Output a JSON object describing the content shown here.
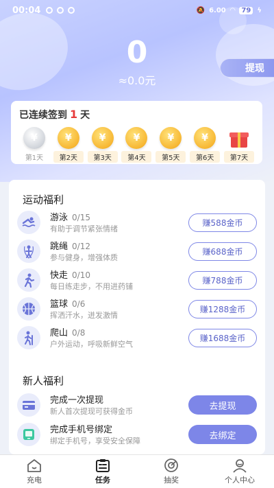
{
  "status_bar": {
    "time": "00:04",
    "network_speed": "6.00",
    "battery": "79"
  },
  "balance": {
    "coins": "0",
    "yuan": "≈0.0元"
  },
  "withdraw_label": "提现",
  "signin": {
    "prefix": "已连续签到",
    "days": "1",
    "suffix": "天",
    "days_list": [
      {
        "label": "第1天",
        "coin": "¥",
        "claimed": true
      },
      {
        "label": "第2天",
        "coin": "¥"
      },
      {
        "label": "第3天",
        "coin": "¥"
      },
      {
        "label": "第4天",
        "coin": "¥"
      },
      {
        "label": "第5天",
        "coin": "¥"
      },
      {
        "label": "第6天",
        "coin": "¥"
      },
      {
        "label": "第7天",
        "icon": "gift-icon"
      }
    ]
  },
  "sports": {
    "title": "运动福利",
    "items": [
      {
        "name": "游泳",
        "count": "0/15",
        "desc": "有助于调节紧张情绪",
        "button": "赚588金币",
        "icon": "swimming-icon"
      },
      {
        "name": "跳绳",
        "count": "0/12",
        "desc": "参与健身，增强体质",
        "button": "赚688金币",
        "icon": "jump-rope-icon"
      },
      {
        "name": "快走",
        "count": "0/10",
        "desc": "每日练走步，不用进药铺",
        "button": "赚788金币",
        "icon": "walking-icon"
      },
      {
        "name": "篮球",
        "count": "0/6",
        "desc": "挥洒汗水，迸发激情",
        "button": "赚1288金币",
        "icon": "basketball-icon"
      },
      {
        "name": "爬山",
        "count": "0/8",
        "desc": "户外运动，呼吸新鲜空气",
        "button": "赚1688金币",
        "icon": "hiking-icon"
      }
    ]
  },
  "newbie": {
    "title": "新人福利",
    "items": [
      {
        "name": "完成一次提现",
        "desc": "新人首次提现可获得金币",
        "button": "去提现",
        "icon": "card-icon"
      },
      {
        "name": "完成手机号绑定",
        "desc": "绑定手机号，享受安全保障",
        "button": "去绑定",
        "icon": "phone-icon"
      }
    ]
  },
  "tabs": [
    {
      "label": "充电",
      "icon": "home-icon"
    },
    {
      "label": "任务",
      "icon": "task-icon",
      "active": true
    },
    {
      "label": "抽奖",
      "icon": "lottery-icon"
    },
    {
      "label": "个人中心",
      "icon": "profile-icon"
    }
  ],
  "colors": {
    "accent": "#7d86e8",
    "highlight": "#e63a3a",
    "coin": "#f7b733"
  }
}
